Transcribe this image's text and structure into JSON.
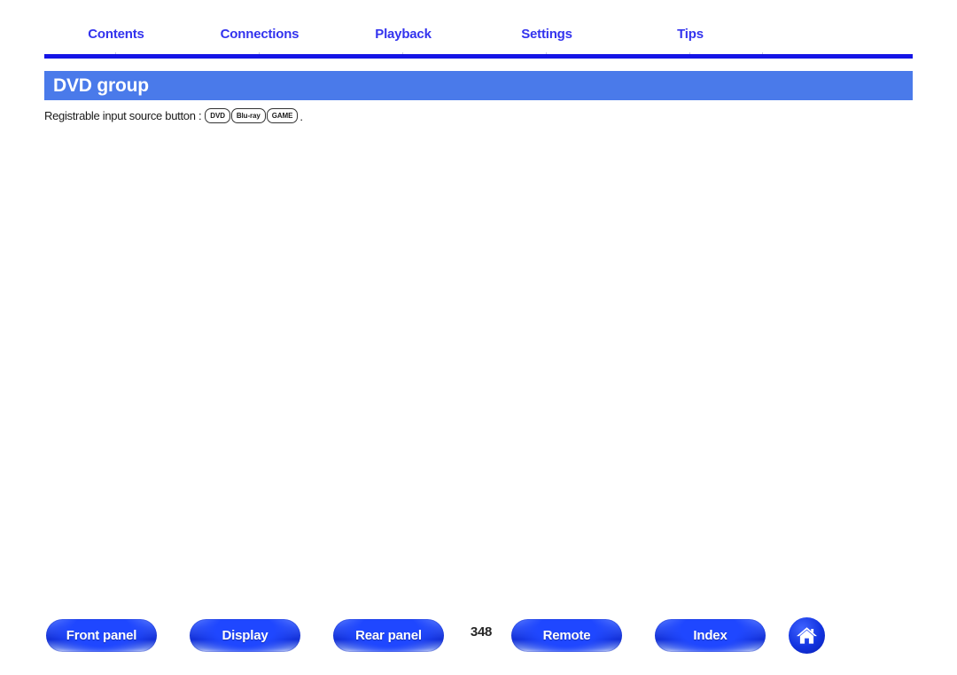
{
  "nav": {
    "tabs": [
      {
        "label": "Contents"
      },
      {
        "label": "Connections"
      },
      {
        "label": "Playback"
      },
      {
        "label": "Settings"
      },
      {
        "label": "Tips"
      }
    ],
    "accent_color": "#3333ee",
    "underline_color": "#1414e6"
  },
  "section": {
    "title": "DVD group",
    "title_bar_color": "#4a7aea",
    "title_text_color": "#ffffff"
  },
  "content": {
    "lead_text": "Registrable input source button :",
    "source_buttons": [
      {
        "label": "DVD"
      },
      {
        "label": "Blu-ray"
      },
      {
        "label": "GAME"
      }
    ],
    "trailing_punctuation": "."
  },
  "footer": {
    "buttons": [
      {
        "label": "Front panel"
      },
      {
        "label": "Display"
      },
      {
        "label": "Rear panel"
      },
      {
        "label": "Remote"
      },
      {
        "label": "Index"
      }
    ],
    "page_number": "348",
    "home_icon": "home-icon",
    "button_color": "#1f47ff"
  }
}
